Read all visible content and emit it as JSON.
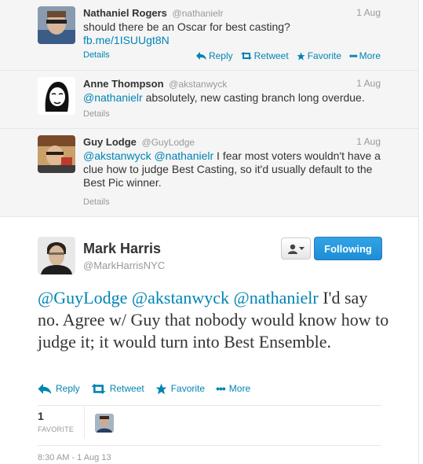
{
  "tweets": [
    {
      "fullname": "Nathaniel Rogers",
      "username": "@nathanielr",
      "time": "1 Aug",
      "text_plain": "should there be an Oscar for best casting?",
      "link": "fb.me/1ISUUgt8N",
      "details": "Details",
      "actions": {
        "reply": "Reply",
        "retweet": "Retweet",
        "favorite": "Favorite",
        "more": "More"
      }
    },
    {
      "fullname": "Anne Thompson",
      "username": "@akstanwyck",
      "time": "1 Aug",
      "mention": "@nathanielr",
      "text_plain": " absolutely, new casting branch long overdue.",
      "details": "Details"
    },
    {
      "fullname": "Guy Lodge",
      "username": "@GuyLodge",
      "time": "1 Aug",
      "mention1": "@akstanwyck",
      "mention2": "@nathanielr",
      "text_plain": " I fear most voters wouldn't have a clue how to judge Best Casting, so it'd usually default to the Best Pic winner.",
      "details": "Details"
    }
  ],
  "main_tweet": {
    "fullname": "Mark Harris",
    "username": "@MarkHarrisNYC",
    "follow_label": "Following",
    "mention1": "@GuyLodge",
    "mention2": "@akstanwyck",
    "mention3": "@nathanielr",
    "text_plain": " I'd say no. Agree w/ Guy that nobody would know how to judge it; it would turn into Best Ensemble.",
    "actions": {
      "reply": "Reply",
      "retweet": "Retweet",
      "favorite": "Favorite",
      "more": "More"
    },
    "favorite_count": "1",
    "favorite_label": "FAVORITE",
    "timestamp": "8:30 AM - 1 Aug 13"
  },
  "colors": {
    "link": "#0084b4",
    "follow_button": "#2b9fe6",
    "reply_background": "#f5f5f5"
  }
}
